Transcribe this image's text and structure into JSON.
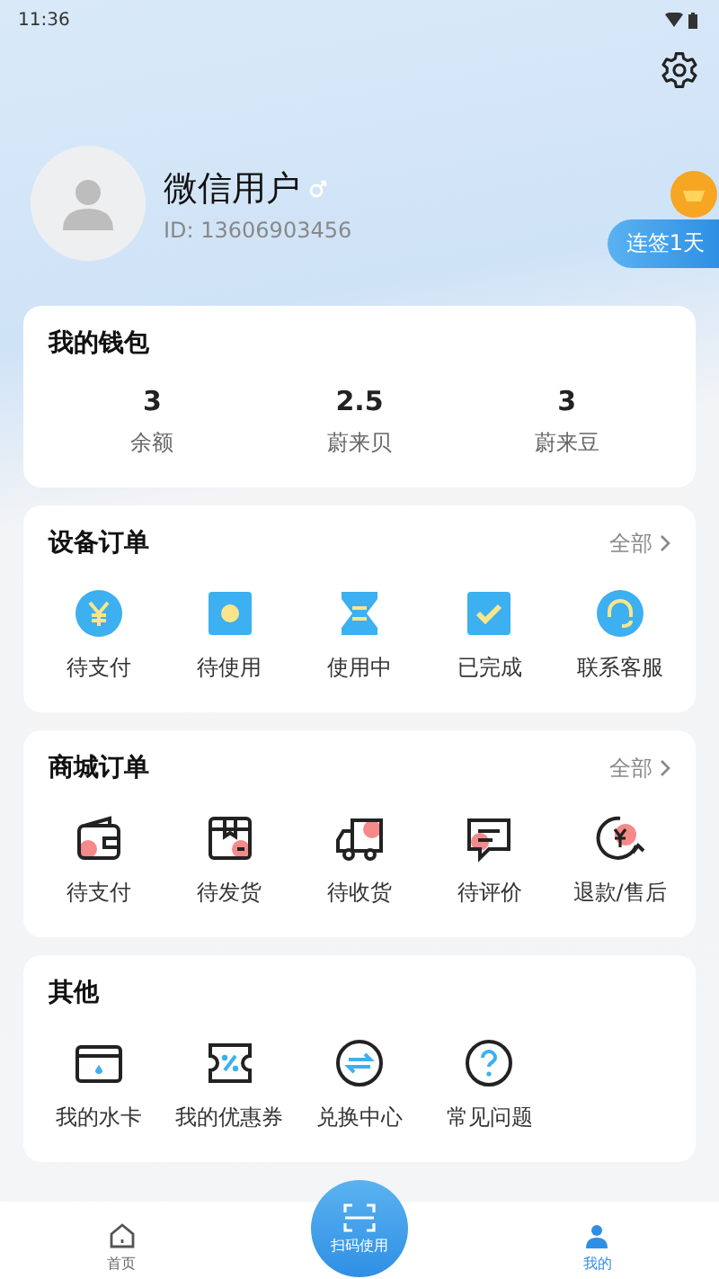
{
  "status_bar": {
    "time": "11:36"
  },
  "profile": {
    "name": "微信用户",
    "id": "ID: 13606903456",
    "checkin": "连签1天"
  },
  "wallet": {
    "title": "我的钱包",
    "stats": [
      {
        "value": "3",
        "label": "余额"
      },
      {
        "value": "2.5",
        "label": "蔚来贝"
      },
      {
        "value": "3",
        "label": "蔚来豆"
      }
    ]
  },
  "device_orders": {
    "title": "设备订单",
    "more": "全部",
    "items": [
      {
        "label": "待支付"
      },
      {
        "label": "待使用"
      },
      {
        "label": "使用中"
      },
      {
        "label": "已完成"
      },
      {
        "label": "联系客服"
      }
    ]
  },
  "mall_orders": {
    "title": "商城订单",
    "more": "全部",
    "items": [
      {
        "label": "待支付"
      },
      {
        "label": "待发货"
      },
      {
        "label": "待收货"
      },
      {
        "label": "待评价"
      },
      {
        "label": "退款/售后"
      }
    ]
  },
  "other": {
    "title": "其他",
    "items": [
      {
        "label": "我的水卡"
      },
      {
        "label": "我的优惠券"
      },
      {
        "label": "兑换中心"
      },
      {
        "label": "常见问题"
      }
    ]
  },
  "tab_bar": {
    "items": [
      {
        "label": "首页",
        "kind": "tab",
        "selected": false
      },
      {
        "label": "扫码使用",
        "kind": "scan"
      },
      {
        "label": "我的",
        "kind": "tab",
        "selected": true
      }
    ]
  }
}
